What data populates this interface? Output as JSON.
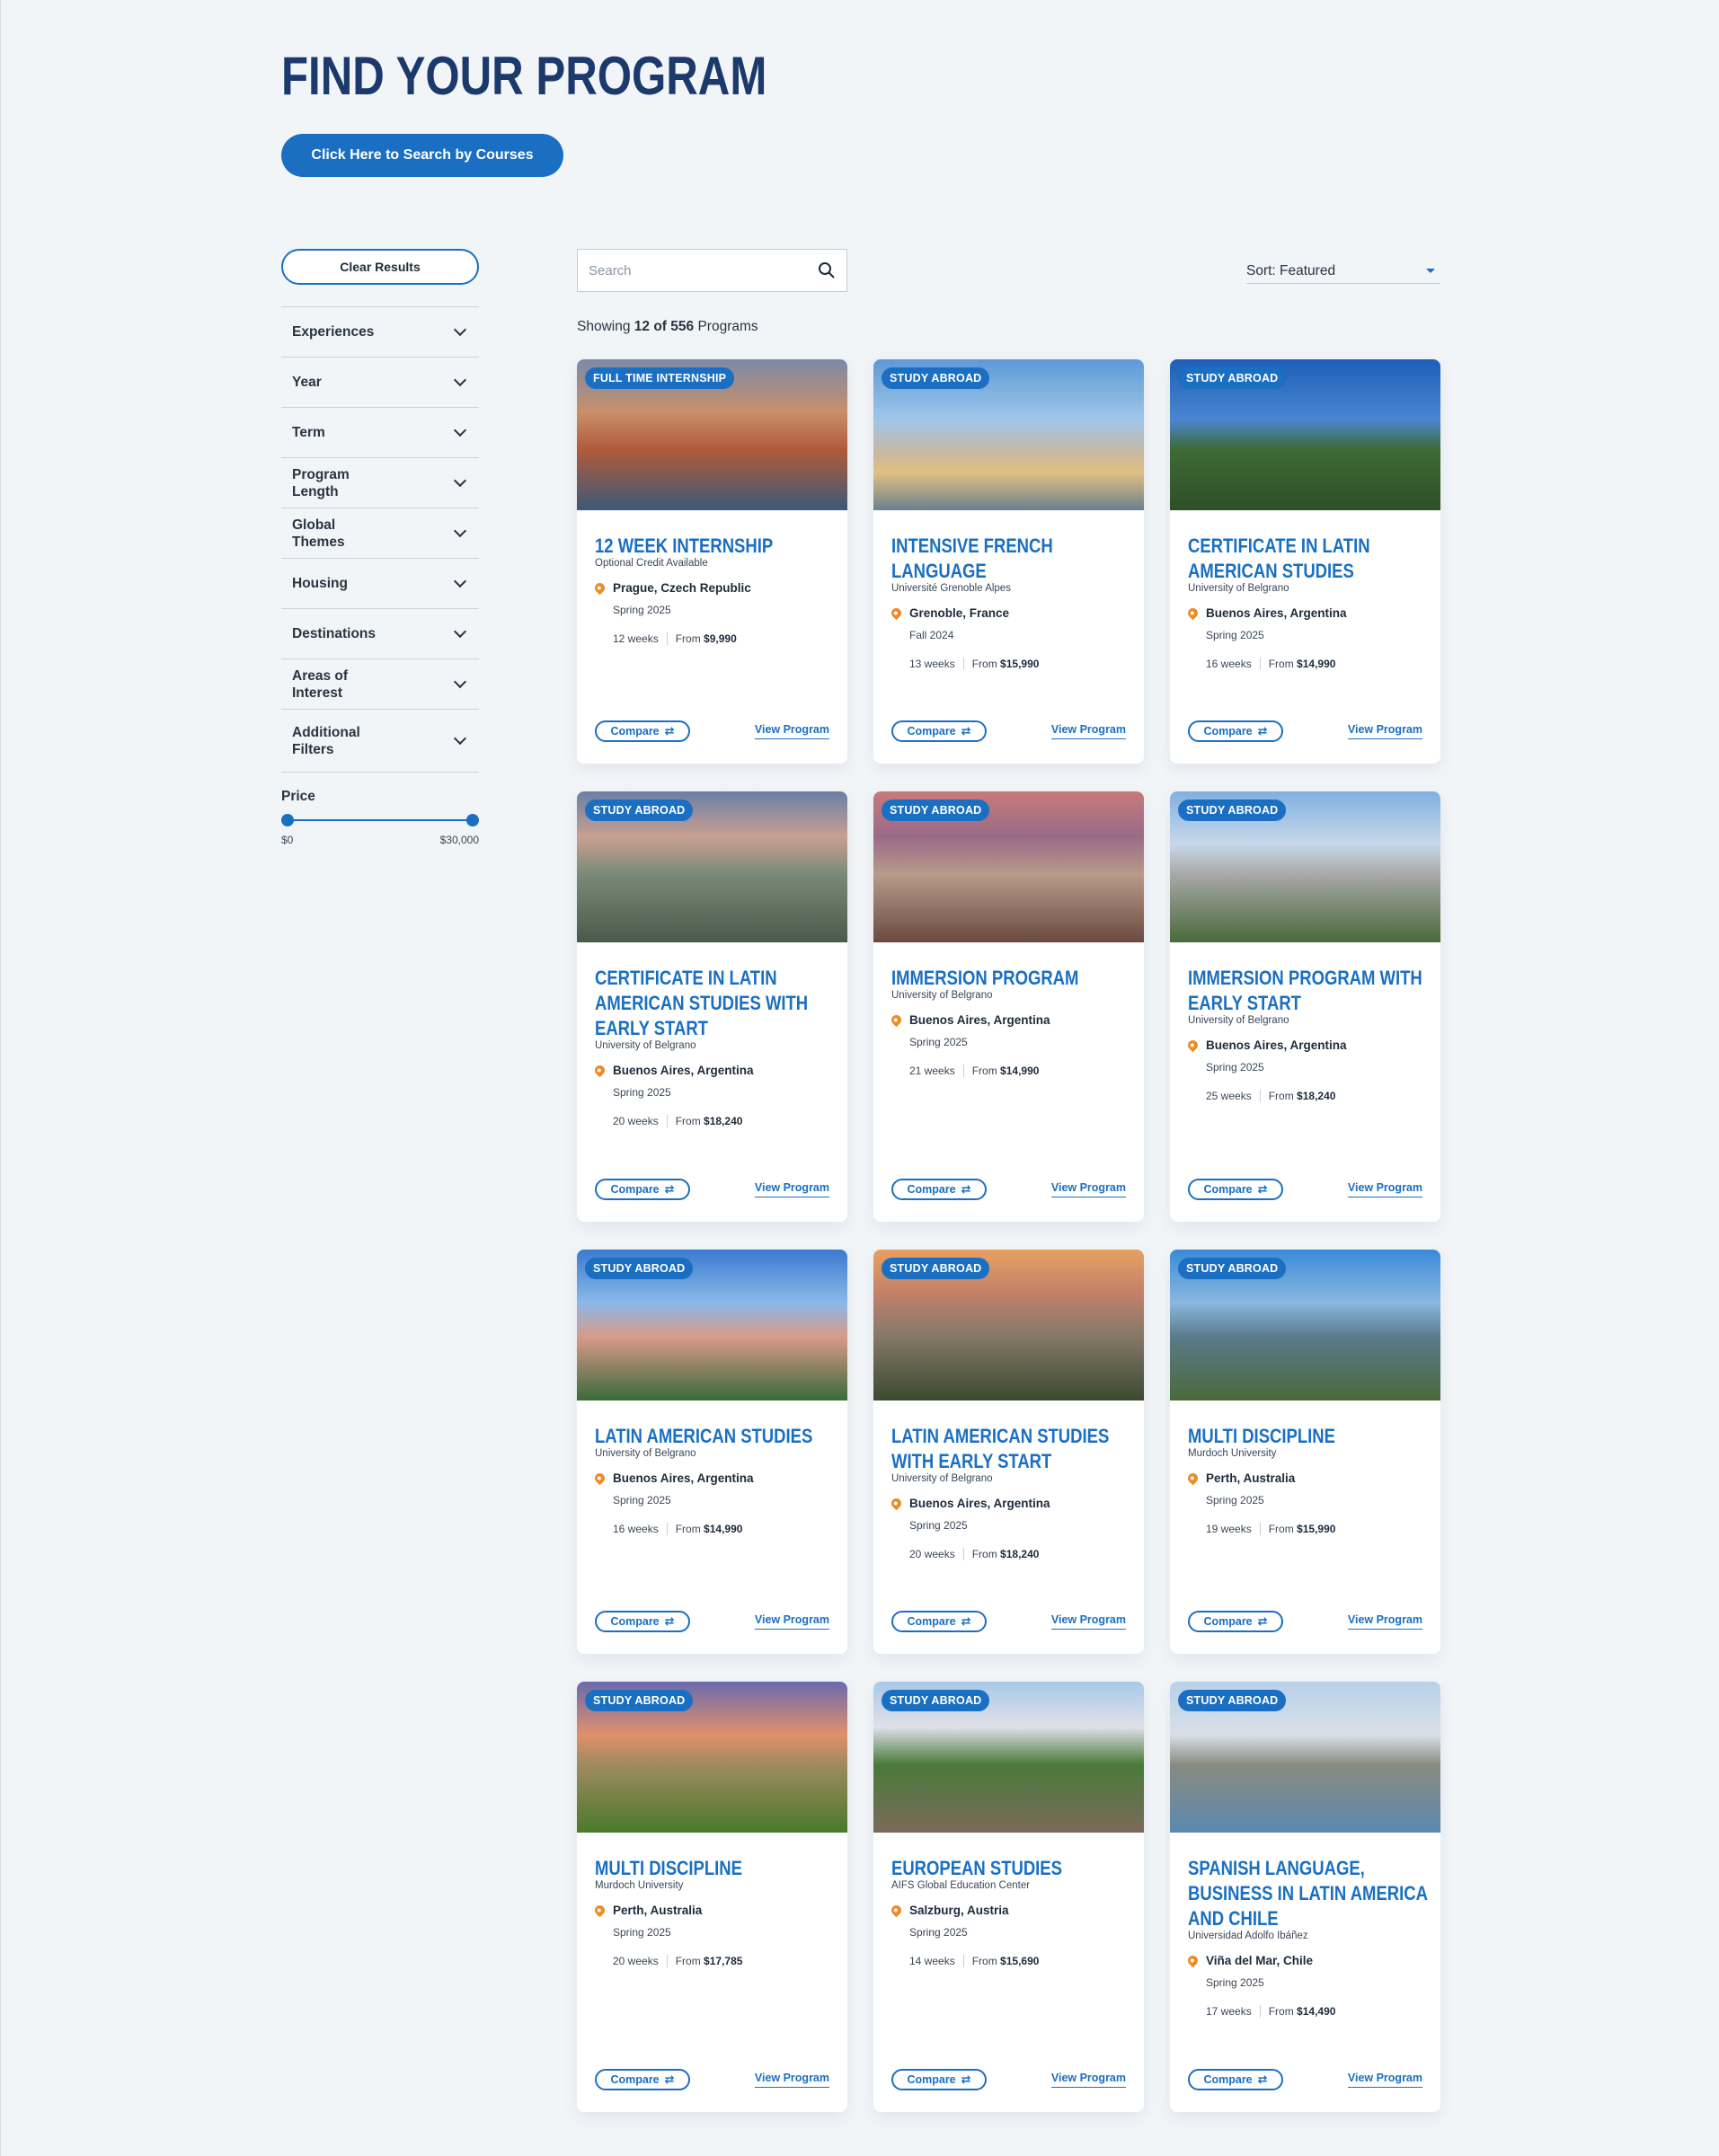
{
  "page": {
    "title": "FIND YOUR PROGRAM",
    "search_courses_label": "Click Here to Search by Courses"
  },
  "sidebar": {
    "clear_label": "Clear Results",
    "filters": [
      "Experiences",
      "Year",
      "Term",
      "Program Length",
      "Global Themes",
      "Housing",
      "Destinations",
      "Areas of Interest",
      "Additional Filters"
    ],
    "price": {
      "title": "Price",
      "min_label": "$0",
      "max_label": "$30,000",
      "low_fraction": 0,
      "high_fraction": 1
    }
  },
  "toolbar": {
    "search_placeholder": "Search",
    "sort_label": "Sort: Featured",
    "showing_prefix": "Showing",
    "showing_count": "12 of 556",
    "showing_suffix": "Programs"
  },
  "cards": [
    {
      "badge": "FULL TIME INTERNSHIP",
      "title": "12 Week Internship",
      "subtitle": "Optional Credit Available",
      "location": "Prague, Czech Republic",
      "term": "Spring 2025",
      "weeks": "12 weeks",
      "price_prefix": "From",
      "price": "$9,990",
      "compare": "Compare",
      "view": "View Program"
    },
    {
      "badge": "STUDY ABROAD",
      "title": "Intensive French Language",
      "subtitle": "Université Grenoble Alpes",
      "location": "Grenoble, France",
      "term": "Fall 2024",
      "weeks": "13 weeks",
      "price_prefix": "From",
      "price": "$15,990",
      "compare": "Compare",
      "view": "View Program"
    },
    {
      "badge": "STUDY ABROAD",
      "title": "Certificate in Latin American Studies",
      "subtitle": "University of Belgrano",
      "location": "Buenos Aires, Argentina",
      "term": "Spring 2025",
      "weeks": "16 weeks",
      "price_prefix": "From",
      "price": "$14,990",
      "compare": "Compare",
      "view": "View Program"
    },
    {
      "badge": "STUDY ABROAD",
      "title": "Certificate in Latin American Studies with Early Start",
      "subtitle": "University of Belgrano",
      "location": "Buenos Aires, Argentina",
      "term": "Spring 2025",
      "weeks": "20 weeks",
      "price_prefix": "From",
      "price": "$18,240",
      "compare": "Compare",
      "view": "View Program"
    },
    {
      "badge": "STUDY ABROAD",
      "title": "Immersion Program",
      "subtitle": "University of Belgrano",
      "location": "Buenos Aires, Argentina",
      "term": "Spring 2025",
      "weeks": "21 weeks",
      "price_prefix": "From",
      "price": "$14,990",
      "compare": "Compare",
      "view": "View Program"
    },
    {
      "badge": "STUDY ABROAD",
      "title": "Immersion Program with Early Start",
      "subtitle": "University of Belgrano",
      "location": "Buenos Aires, Argentina",
      "term": "Spring 2025",
      "weeks": "25 weeks",
      "price_prefix": "From",
      "price": "$18,240",
      "compare": "Compare",
      "view": "View Program"
    },
    {
      "badge": "STUDY ABROAD",
      "title": "Latin American Studies",
      "subtitle": "University of Belgrano",
      "location": "Buenos Aires, Argentina",
      "term": "Spring 2025",
      "weeks": "16 weeks",
      "price_prefix": "From",
      "price": "$14,990",
      "compare": "Compare",
      "view": "View Program"
    },
    {
      "badge": "STUDY ABROAD",
      "title": "Latin American Studies with Early Start",
      "subtitle": "University of Belgrano",
      "location": "Buenos Aires, Argentina",
      "term": "Spring 2025",
      "weeks": "20 weeks",
      "price_prefix": "From",
      "price": "$18,240",
      "compare": "Compare",
      "view": "View Program"
    },
    {
      "badge": "STUDY ABROAD",
      "title": "Multi Discipline",
      "subtitle": "Murdoch University",
      "location": "Perth, Australia",
      "term": "Spring 2025",
      "weeks": "19 weeks",
      "price_prefix": "From",
      "price": "$15,990",
      "compare": "Compare",
      "view": "View Program"
    },
    {
      "badge": "STUDY ABROAD",
      "title": "Multi Discipline",
      "subtitle": "Murdoch University",
      "location": "Perth, Australia",
      "term": "Spring 2025",
      "weeks": "20 weeks",
      "price_prefix": "From",
      "price": "$17,785",
      "compare": "Compare",
      "view": "View Program"
    },
    {
      "badge": "STUDY ABROAD",
      "title": "European Studies",
      "subtitle": "AIFS Global Education Center",
      "location": "Salzburg, Austria",
      "term": "Spring 2025",
      "weeks": "14 weeks",
      "price_prefix": "From",
      "price": "$15,690",
      "compare": "Compare",
      "view": "View Program"
    },
    {
      "badge": "STUDY ABROAD",
      "title": "Spanish Language, Business in Latin America and Chile",
      "subtitle": "Universidad Adolfo Ibáñez",
      "location": "Viña del Mar, Chile",
      "term": "Spring 2025",
      "weeks": "17 weeks",
      "price_prefix": "From",
      "price": "$14,490",
      "compare": "Compare",
      "view": "View Program"
    }
  ],
  "colors": {
    "accent": "#1a6fc2",
    "heading": "#1b3a6b",
    "pin": "#f08a24",
    "background": "#f2f5f8"
  }
}
